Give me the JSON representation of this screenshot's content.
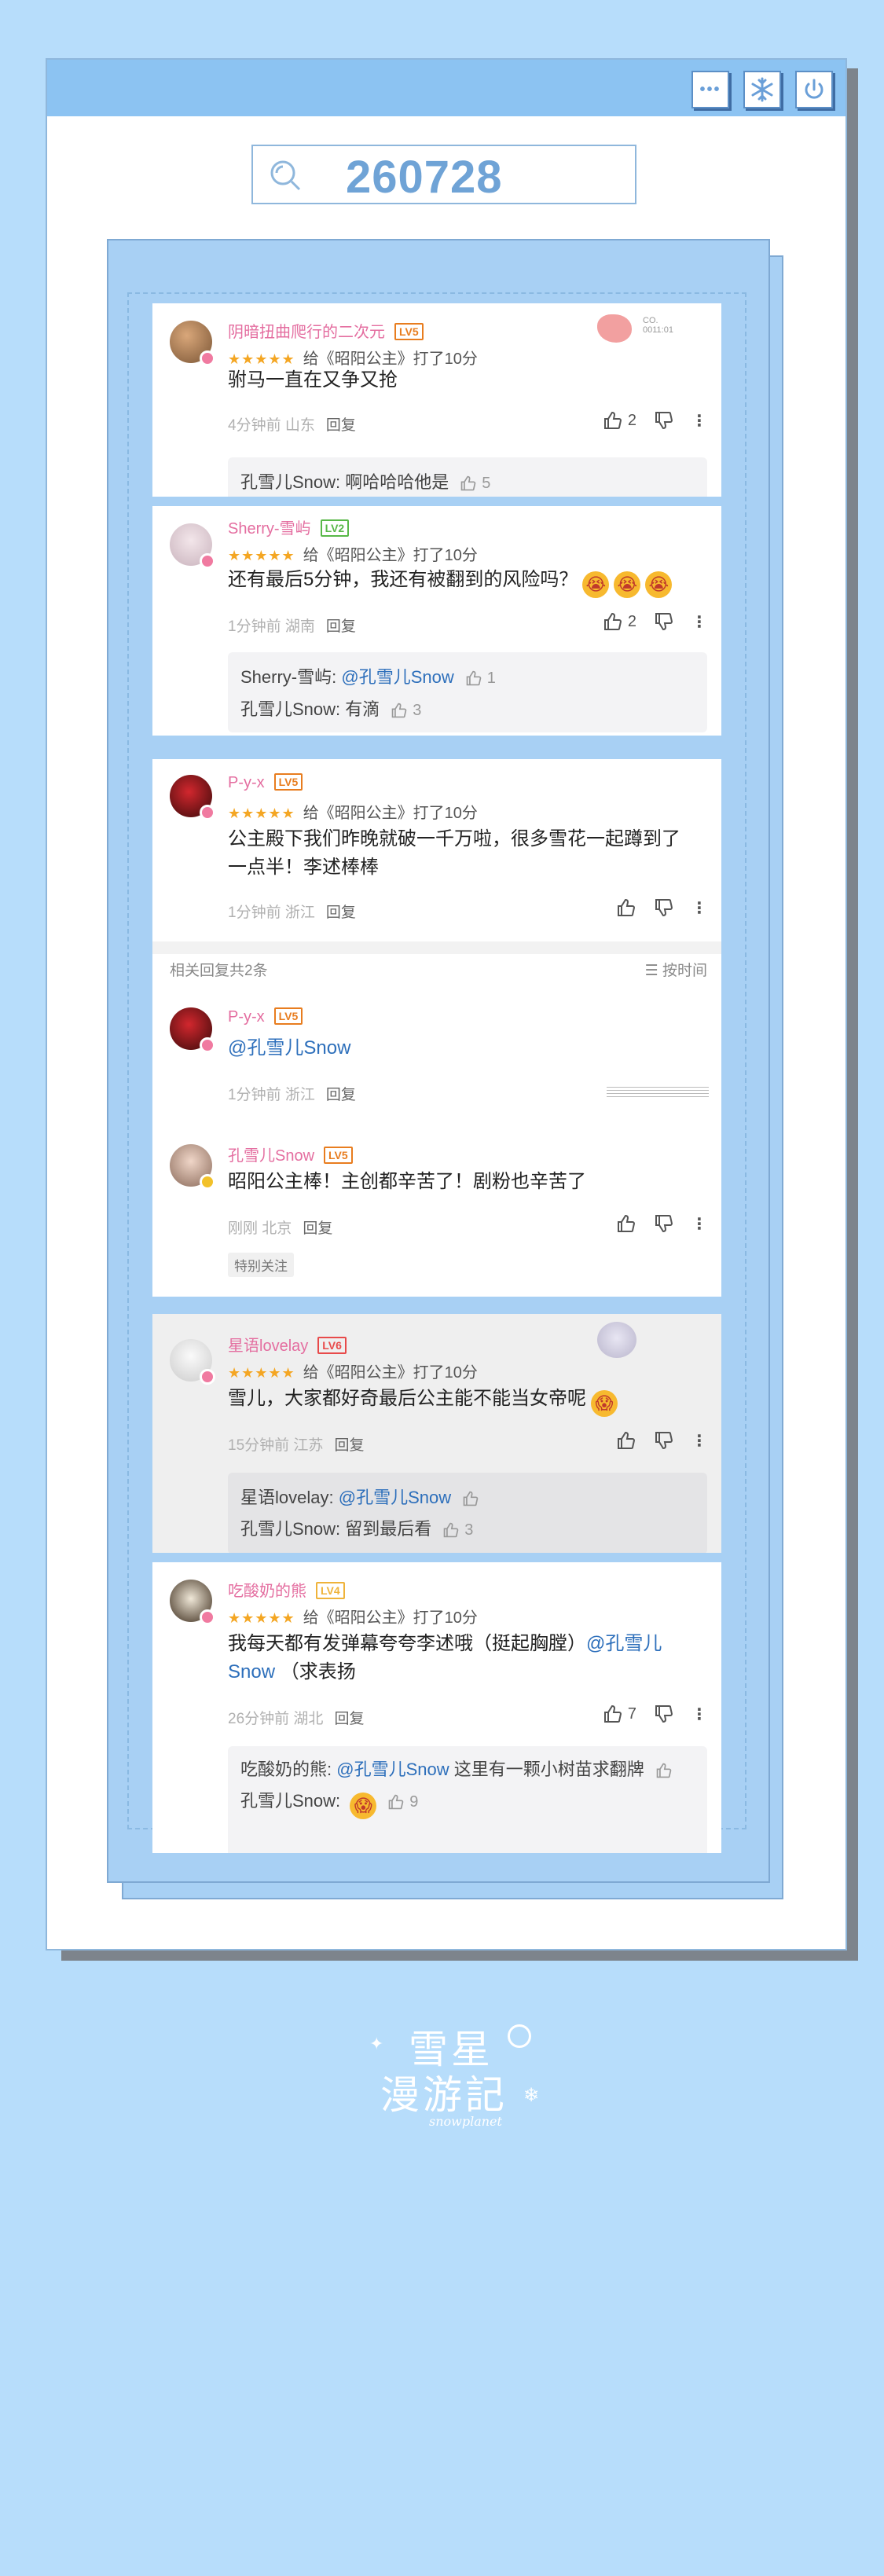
{
  "search": {
    "query": "260728"
  },
  "window_buttons": {
    "dots": "•••"
  },
  "comments": [
    {
      "user": "阴暗扭曲爬行的二次元",
      "level": "LV5",
      "rating_text": "给《昭阳公主》打了10分",
      "text": "驸马一直在又争又抢",
      "time": "4分钟前",
      "location": "山东",
      "reply_label": "回复",
      "likes": "2",
      "deco_text": "CO.",
      "deco_text2": "0011:01",
      "replies": [
        {
          "author": "孔雪儿Snow:",
          "text": "啊哈哈哈他是",
          "likes": "5"
        }
      ]
    },
    {
      "user": "Sherry-雪屿",
      "level": "LV2",
      "rating_text": "给《昭阳公主》打了10分",
      "text": "还有最后5分钟，我还有被翻到的风险吗？",
      "time": "1分钟前",
      "location": "湖南",
      "reply_label": "回复",
      "likes": "2",
      "replies": [
        {
          "author": "Sherry-雪屿:",
          "mention": "@孔雪儿Snow",
          "likes": "1"
        },
        {
          "author": "孔雪儿Snow:",
          "text": "有滴",
          "likes": "3"
        }
      ]
    },
    {
      "user": "P-y-x",
      "level": "LV5",
      "rating_text": "给《昭阳公主》打了10分",
      "text": "公主殿下我们昨晚就破一千万啦，很多雪花一起蹲到了一点半！李述棒棒",
      "time": "1分钟前",
      "location": "浙江",
      "reply_label": "回复"
    }
  ],
  "related": {
    "label": "相关回复共2条",
    "sort": "按时间"
  },
  "sub_replies": [
    {
      "user": "P-y-x",
      "level": "LV5",
      "mention": "@孔雪儿Snow",
      "time": "1分钟前",
      "location": "浙江",
      "reply_label": "回复"
    },
    {
      "user": "孔雪儿Snow",
      "level": "LV5",
      "text": "昭阳公主棒！主创都辛苦了！剧粉也辛苦了",
      "time": "刚刚",
      "location": "北京",
      "reply_label": "回复",
      "tag": "特别关注"
    }
  ],
  "comments2": [
    {
      "user": "星语lovelay",
      "level": "LV6",
      "rating_text": "给《昭阳公主》打了10分",
      "text": "雪儿，大家都好奇最后公主能不能当女帝呢",
      "time": "15分钟前",
      "location": "江苏",
      "reply_label": "回复",
      "replies": [
        {
          "author": "星语lovelay:",
          "mention": "@孔雪儿Snow"
        },
        {
          "author": "孔雪儿Snow:",
          "text": "留到最后看",
          "likes": "3"
        }
      ]
    },
    {
      "user": "吃酸奶的熊",
      "level": "LV4",
      "rating_text": "给《昭阳公主》打了10分",
      "text": "我每天都有发弹幕夸夸李述哦（挺起胸膛）",
      "mention": "@孔雪儿Snow",
      "text_end": "（求表扬",
      "time": "26分钟前",
      "location": "湖北",
      "reply_label": "回复",
      "likes": "7",
      "replies": [
        {
          "author": "吃酸奶的熊:",
          "mention": "@孔雪儿Snow",
          "text": "这里有一颗小树苗求翻牌"
        },
        {
          "author": "孔雪儿Snow:",
          "likes": "9"
        }
      ]
    }
  ],
  "logo": {
    "line1": "雪星",
    "line2": "漫游記",
    "sub": "snowplanet"
  },
  "colors": {
    "background": "#b7ddfb",
    "accent": "#8cc3f2",
    "username": "#e46ea0",
    "star": "#f4a623",
    "mention": "#2d6fbb"
  }
}
